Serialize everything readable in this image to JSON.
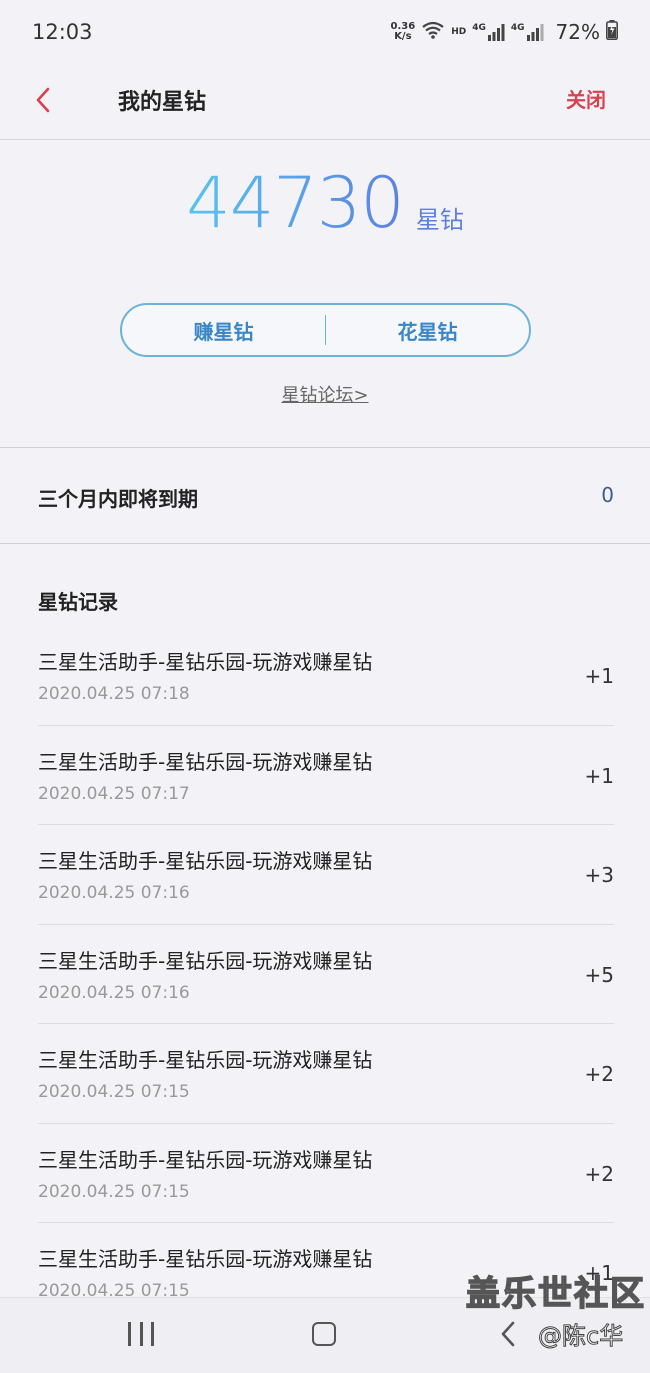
{
  "status_bar": {
    "time": "12:03",
    "net_speed_value": "0.36",
    "net_speed_unit": "K/s",
    "hd_label": "HD",
    "sim1_label": "4G",
    "sim2_label": "4G",
    "battery": "72%"
  },
  "header": {
    "title": "我的星钻",
    "close_label": "关闭"
  },
  "balance": {
    "amount": "44730",
    "unit": "星钻",
    "earn_label": "赚星钻",
    "spend_label": "花星钻",
    "forum_link": "星钻论坛>"
  },
  "expiring": {
    "label": "三个月内即将到期",
    "count": "0"
  },
  "records": {
    "title": "星钻记录",
    "items": [
      {
        "name": "三星生活助手-星钻乐园-玩游戏赚星钻",
        "time": "2020.04.25 07:18",
        "amount": "+1"
      },
      {
        "name": "三星生活助手-星钻乐园-玩游戏赚星钻",
        "time": "2020.04.25 07:17",
        "amount": "+1"
      },
      {
        "name": "三星生活助手-星钻乐园-玩游戏赚星钻",
        "time": "2020.04.25 07:16",
        "amount": "+3"
      },
      {
        "name": "三星生活助手-星钻乐园-玩游戏赚星钻",
        "time": "2020.04.25 07:16",
        "amount": "+5"
      },
      {
        "name": "三星生活助手-星钻乐园-玩游戏赚星钻",
        "time": "2020.04.25 07:15",
        "amount": "+2"
      },
      {
        "name": "三星生活助手-星钻乐园-玩游戏赚星钻",
        "time": "2020.04.25 07:15",
        "amount": "+2"
      },
      {
        "name": "三星生活助手-星钻乐园-玩游戏赚星钻",
        "time": "2020.04.25 07:15",
        "amount": "+1"
      }
    ]
  },
  "watermark": {
    "logo": "盖乐世社区",
    "user": "@陈c华"
  },
  "colors": {
    "accent_red": "#d9424f",
    "balance_gradient_start": "#58c4ee",
    "balance_gradient_end": "#5e7fe0",
    "pill_border": "#6db3d8",
    "pill_text": "#3a86c6",
    "background": "#f3f3f7"
  },
  "icons": {
    "back": "chevron-left-icon",
    "wifi": "wifi-icon",
    "signal": "signal-icon",
    "battery": "battery-charging-icon",
    "nav_recent": "recent-apps-icon",
    "nav_home": "home-icon",
    "nav_back": "back-icon"
  }
}
